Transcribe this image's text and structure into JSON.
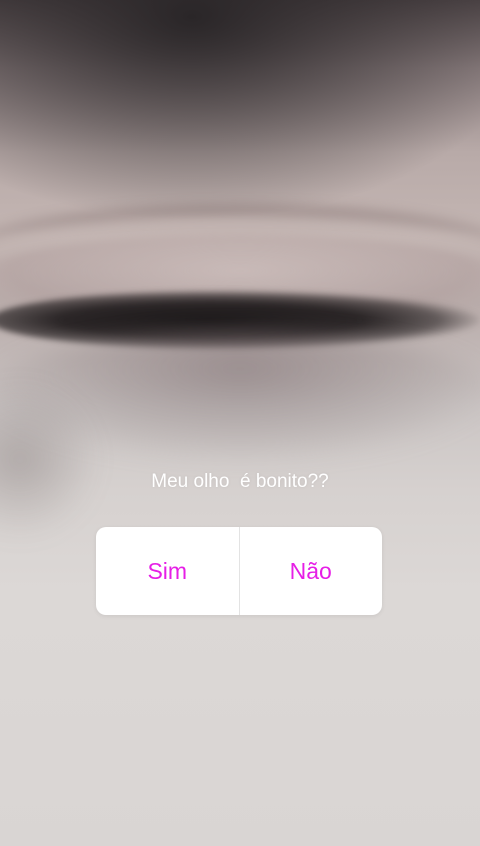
{
  "story": {
    "question": "Meu olho  é bonito??"
  },
  "poll": {
    "options": [
      "Sim",
      "Não"
    ],
    "accent_color": "#e61ee6"
  }
}
